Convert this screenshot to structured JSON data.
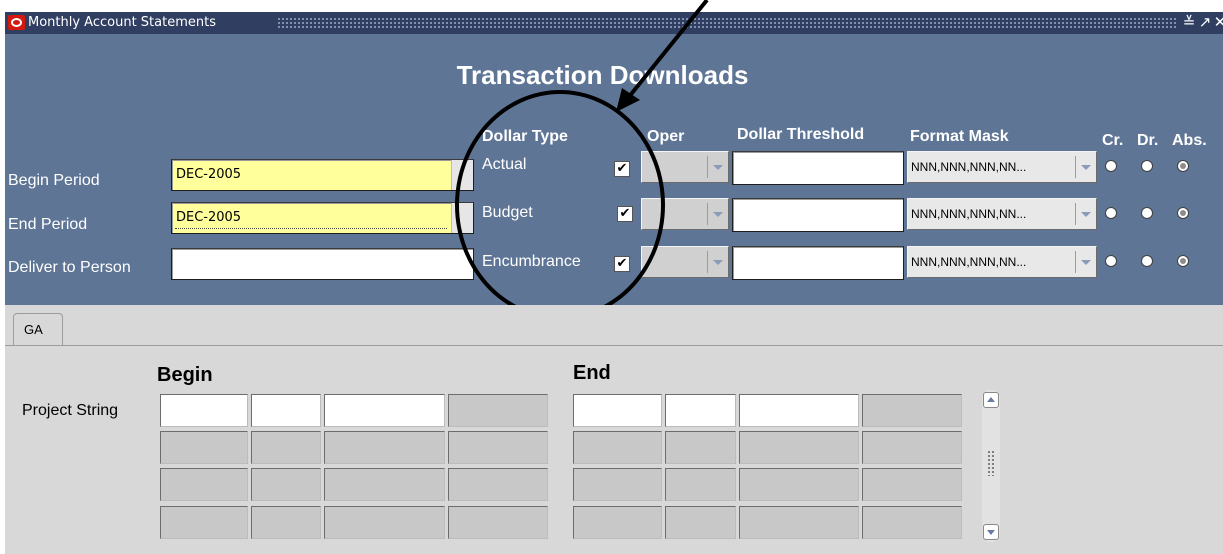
{
  "window": {
    "title": "Monthly Account Statements",
    "minimize_glyph": "≚",
    "maximize_glyph": "↗",
    "close_glyph": "✕"
  },
  "header": {
    "main_title": "Transaction Downloads",
    "fields": {
      "begin_period_label": "Begin Period",
      "begin_period_value": "DEC-2005",
      "end_period_label": "End Period",
      "end_period_value": "DEC-2005",
      "deliver_to_label": "Deliver to Person",
      "deliver_to_value": ""
    },
    "columns": {
      "dollar_type": "Dollar Type",
      "oper": "Oper",
      "dollar_threshold": "Dollar Threshold",
      "format_mask": "Format Mask",
      "cr": "Cr.",
      "dr": "Dr.",
      "abs": "Abs."
    },
    "rows": [
      {
        "type": "Actual",
        "checked": true,
        "check_glyph": "✔",
        "oper": "",
        "threshold": "",
        "format_mask": "NNN,NNN,NNN,NN...",
        "selected": "abs"
      },
      {
        "type": "Budget",
        "checked": true,
        "check_glyph": "✔",
        "oper": "",
        "threshold": "",
        "format_mask": "NNN,NNN,NNN,NN...",
        "selected": "abs"
      },
      {
        "type": "Encumbrance",
        "checked": true,
        "check_glyph": "✔",
        "oper": "",
        "threshold": "",
        "format_mask": "NNN,NNN,NNN,NN...",
        "selected": "abs"
      }
    ]
  },
  "tabs": [
    {
      "label": "GA",
      "active": true
    }
  ],
  "ga_panel": {
    "begin_label": "Begin",
    "end_label": "End",
    "row_label": "Project String"
  },
  "icons": {
    "app": "oracle-logo-icon",
    "scroll_up": "scroll-up-icon",
    "scroll_down": "scroll-down-icon"
  },
  "colors": {
    "title_bar": "#2f3e61",
    "header_bg": "#5e7596",
    "required_field": "#ffff9c",
    "panel_bg": "#d8d8d8",
    "oracle_red": "#d4170f"
  }
}
